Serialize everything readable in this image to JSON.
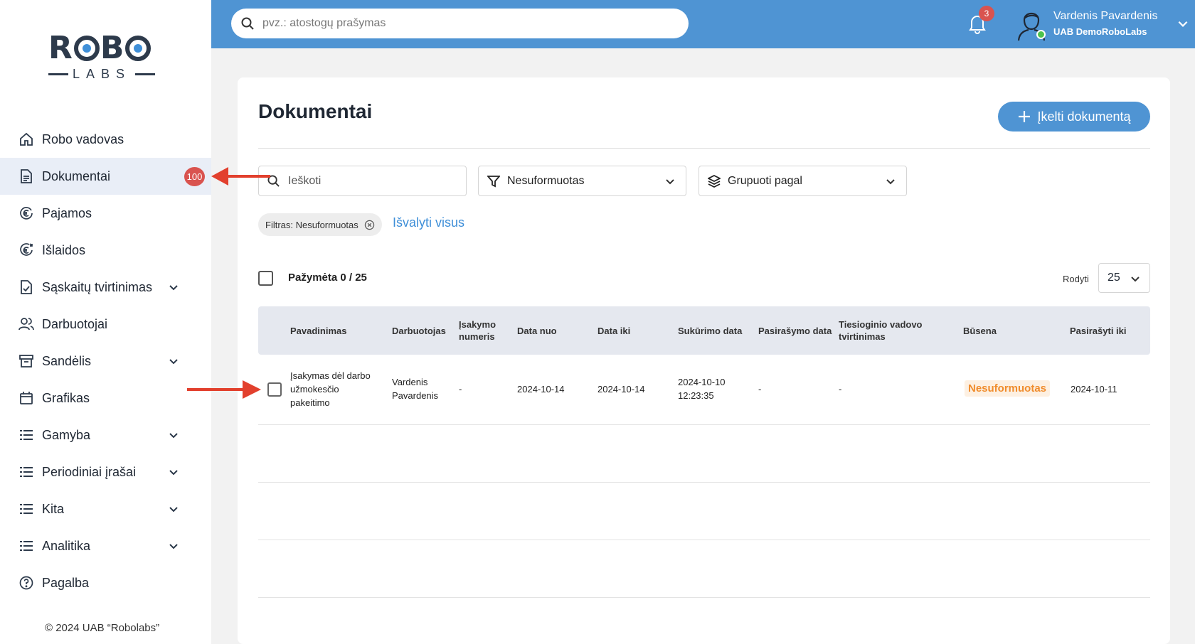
{
  "brand": {
    "logo_top": "ROBO",
    "logo_bottom": "LABS"
  },
  "sidebar": {
    "items": [
      {
        "label": "Robo vadovas",
        "icon": "home-icon",
        "chevron": false
      },
      {
        "label": "Dokumentai",
        "icon": "document-icon",
        "chevron": false,
        "badge": "100",
        "active": true
      },
      {
        "label": "Pajamos",
        "icon": "euro-in-icon",
        "chevron": false
      },
      {
        "label": "Išlaidos",
        "icon": "euro-out-icon",
        "chevron": false
      },
      {
        "label": "Sąskaitų tvirtinimas",
        "icon": "invoice-check-icon",
        "chevron": true
      },
      {
        "label": "Darbuotojai",
        "icon": "users-icon",
        "chevron": false
      },
      {
        "label": "Sandėlis",
        "icon": "archive-icon",
        "chevron": true
      },
      {
        "label": "Grafikas",
        "icon": "calendar-icon",
        "chevron": false
      },
      {
        "label": "Gamyba",
        "icon": "list-icon",
        "chevron": true
      },
      {
        "label": "Periodiniai įrašai",
        "icon": "list-icon",
        "chevron": true
      },
      {
        "label": "Kita",
        "icon": "list-icon",
        "chevron": true
      },
      {
        "label": "Analitika",
        "icon": "list-icon",
        "chevron": true
      },
      {
        "label": "Pagalba",
        "icon": "help-icon",
        "chevron": false
      }
    ],
    "copyright": "© 2024 UAB “Robolabs”"
  },
  "topbar": {
    "search_placeholder": "pvz.: atostogų prašymas",
    "notifications_count": "3",
    "user_name": "Vardenis Pavardenis",
    "company": "UAB DemoRoboLabs"
  },
  "main": {
    "title": "Dokumentai",
    "upload_label": "Įkelti dokumentą",
    "search_placeholder": "Ieškoti",
    "status_filter": "Nesuformuotas",
    "group_by": "Grupuoti pagal",
    "filter_chip": "Filtras: Nesuformuotas",
    "clear_all": "Išvalyti visus",
    "selected": "Pažymėta 0 / 25",
    "show_label": "Rodyti",
    "page_size": "25",
    "columns": [
      "Pavadinimas",
      "Darbuotojas",
      "Įsakymo numeris",
      "Data nuo",
      "Data iki",
      "Sukūrimo data",
      "Pasirašymo data",
      "Tiesioginio vadovo tvirtinimas",
      "Būsena",
      "Pasirašyti iki"
    ],
    "rows": [
      {
        "name": "Įsakymas dėl darbo užmokesčio pakeitimo",
        "employee": "Vardenis Pavardenis",
        "order_number": "-",
        "date_from": "2024-10-14",
        "date_to": "2024-10-14",
        "created": "2024-10-10 12:23:35",
        "signed": "-",
        "manager_approval": "-",
        "status": "Nesuformuotas",
        "sign_until": "2024-10-11"
      }
    ]
  },
  "colors": {
    "accent": "#4f94d3",
    "badge": "#d9534f",
    "status_orange": "#f08c2c",
    "annotation_arrow": "#e2402d"
  }
}
